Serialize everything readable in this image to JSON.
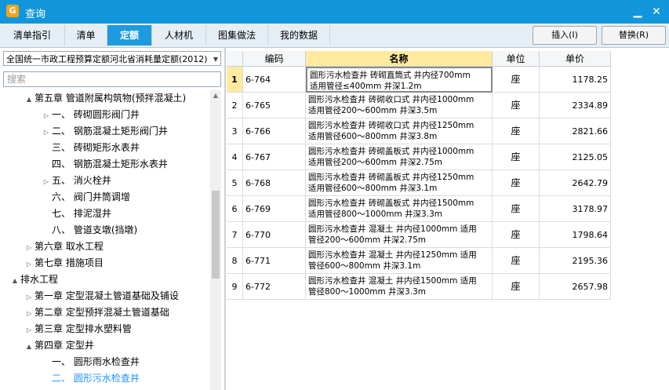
{
  "window": {
    "title": "查询",
    "app_icon": "app-logo-icon",
    "minimize": "▁",
    "close": "✕"
  },
  "tabs": [
    {
      "label": "清单指引"
    },
    {
      "label": "清单"
    },
    {
      "label": "定额"
    },
    {
      "label": "人材机"
    },
    {
      "label": "图集做法"
    },
    {
      "label": "我的数据"
    }
  ],
  "active_tab": "定额",
  "actions": {
    "insert": "插入(I)",
    "replace": "替换(R)"
  },
  "library": {
    "selected": "全国统一市政工程预算定额河北省消耗量定额(2012)"
  },
  "search": {
    "placeholder": "搜索"
  },
  "tree": [
    {
      "label": "第五章  管道附属构筑物(预拌混凝土)",
      "toggle": "▲"
    },
    {
      "label": "一、  砖砌圆形阀门井",
      "toggle": "▷"
    },
    {
      "label": "二、  钢筋混凝土矩形阀门井",
      "toggle": "▷"
    },
    {
      "label": "三、  砖砌矩形水表井",
      "toggle": ""
    },
    {
      "label": "四、  钢筋混凝土矩形水表井",
      "toggle": ""
    },
    {
      "label": "五、  消火栓井",
      "toggle": "▷"
    },
    {
      "label": "六、  阀门井筒调增",
      "toggle": ""
    },
    {
      "label": "七、  排泥湿井",
      "toggle": ""
    },
    {
      "label": "八、  管道支墩(挡墩)",
      "toggle": ""
    },
    {
      "label": "第六章  取水工程",
      "toggle": "▷"
    },
    {
      "label": "第七章  措施项目",
      "toggle": "▷"
    },
    {
      "label": "排水工程",
      "toggle": "▲"
    },
    {
      "label": "第一章  定型混凝土管道基础及铺设",
      "toggle": "▷"
    },
    {
      "label": "第二章  定型预拌混凝土管道基础",
      "toggle": "▷"
    },
    {
      "label": "第三章  定型排水塑料管",
      "toggle": "▷"
    },
    {
      "label": "第四章  定型井",
      "toggle": "▲"
    },
    {
      "label": "一、  圆形雨水检查井",
      "toggle": ""
    },
    {
      "label": "二、  圆形污水检查井",
      "toggle": ""
    }
  ],
  "selected_tree_item": "二、  圆形污水检查井",
  "table": {
    "columns": [
      "编码",
      "名称",
      "单位",
      "单价"
    ],
    "current_row": "1",
    "rows": [
      {
        "num": "1",
        "code": "6-764",
        "name1": "圆形污水检查井  砖砌直筒式  井内径700mm",
        "name2": "适用管径≤400mm  井深1.2m",
        "unit": "座",
        "price": "1178.25"
      },
      {
        "num": "2",
        "code": "6-765",
        "name1": "圆形污水检查井  砖砌收口式  井内径1000mm",
        "name2": "适用管径200～600mm  井深3.5m",
        "unit": "座",
        "price": "2334.89"
      },
      {
        "num": "3",
        "code": "6-766",
        "name1": "圆形污水检查井  砖砌收口式  井内径1250mm",
        "name2": "适用管径600～800mm  井深3.8m",
        "unit": "座",
        "price": "2821.66"
      },
      {
        "num": "4",
        "code": "6-767",
        "name1": "圆形污水检查井  砖砌盖板式  井内径1000mm",
        "name2": "适用管径200～600mm  井深2.75m",
        "unit": "座",
        "price": "2125.05"
      },
      {
        "num": "5",
        "code": "6-768",
        "name1": "圆形污水检查井  砖砌盖板式  井内径1250mm",
        "name2": "适用管径600～800mm  井深3.1m",
        "unit": "座",
        "price": "2642.79"
      },
      {
        "num": "6",
        "code": "6-769",
        "name1": "圆形污水检查井  砖砌盖板式  井内径1500mm",
        "name2": "适用管径800～1000mm  井深3.3m",
        "unit": "座",
        "price": "3178.97"
      },
      {
        "num": "7",
        "code": "6-770",
        "name1": "圆形污水检查井  混凝土  井内径1000mm  适用",
        "name2": "管径200～600mm  井深2.75m",
        "unit": "座",
        "price": "1798.64"
      },
      {
        "num": "8",
        "code": "6-771",
        "name1": "圆形污水检查井  混凝土  井内径1250mm  适用",
        "name2": "管径600～800mm  井深3.1m",
        "unit": "座",
        "price": "2195.36"
      },
      {
        "num": "9",
        "code": "6-772",
        "name1": "圆形污水检查井  混凝土  井内径1500mm  适用",
        "name2": "管径800～1000mm  井深3.3m",
        "unit": "座",
        "price": "2657.98"
      }
    ]
  }
}
